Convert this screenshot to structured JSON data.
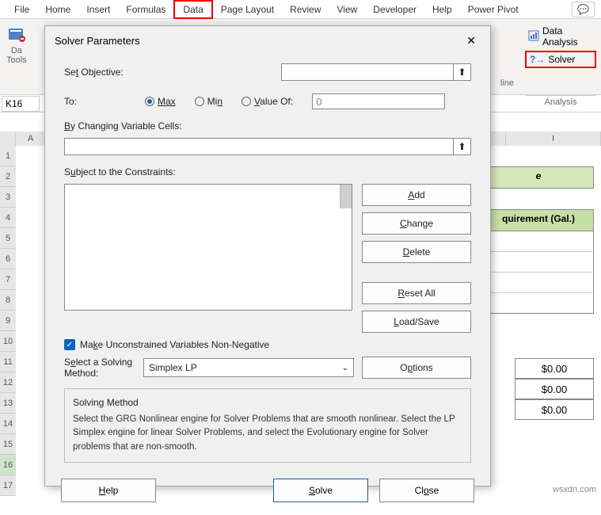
{
  "ribbon": {
    "tabs": [
      "File",
      "Home",
      "Insert",
      "Formulas",
      "Data",
      "Page Layout",
      "Review",
      "View",
      "Developer",
      "Help",
      "Power Pivot"
    ],
    "active": "Data",
    "dataToolsLine1": "Da",
    "dataToolsLine2": "Tools",
    "lineLabel": "line",
    "analysis": {
      "dataAnalysis": "Data Analysis",
      "solver": "Solver",
      "groupLabel": "Analysis"
    },
    "commentGlyph": "💬"
  },
  "namebox": {
    "ref": "K16"
  },
  "columns": [
    "A",
    "I"
  ],
  "rows": [
    "1",
    "2",
    "3",
    "4",
    "5",
    "6",
    "7",
    "8",
    "9",
    "10",
    "11",
    "12",
    "13",
    "14",
    "15",
    "16",
    "17"
  ],
  "sheet": {
    "title_suffix": "e",
    "header2": "quirement (Gal.)",
    "money": [
      "$0.00",
      "$0.00",
      "$0.00"
    ]
  },
  "dialog": {
    "title": "Solver Parameters",
    "setObjective": "Set Objective:",
    "objectiveValue": "",
    "to": "To:",
    "max": "Max",
    "min": "Min",
    "valueOf": "Value Of:",
    "valueOfVal": "0",
    "changingCells": "By Changing Variable Cells:",
    "changingValue": "",
    "constraintsLabel": "Subject to the Constraints:",
    "buttons": {
      "add": "Add",
      "change": "Change",
      "delete": "Delete",
      "resetAll": "Reset All",
      "loadSave": "Load/Save",
      "options": "Options"
    },
    "makeNonNeg": "Make Unconstrained Variables Non-Negative",
    "selectMethodLbl1": "Select a Solving",
    "selectMethodLbl2": "Method:",
    "methodValue": "Simplex LP",
    "descTitle": "Solving Method",
    "descText": "Select the GRG Nonlinear engine for Solver Problems that are smooth nonlinear. Select the LP Simplex engine for linear Solver Problems, and select the Evolutionary engine for Solver problems that are non-smooth.",
    "help": "Help",
    "solve": "Solve",
    "close": "Close"
  },
  "watermark": "wsxdn.com"
}
